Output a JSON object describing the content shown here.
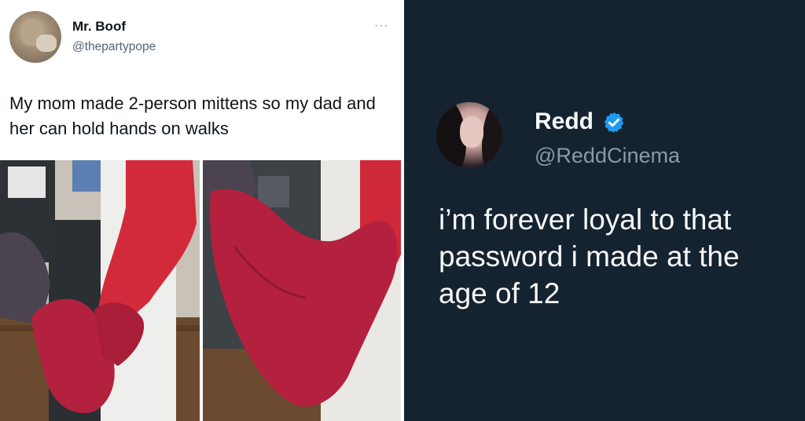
{
  "left_tweet": {
    "name": "Mr. Boof",
    "handle": "@thepartypope",
    "more_icon": "···",
    "text": "My mom made 2-person mittens so my dad and her can hold hands on walks",
    "photos": [
      "mittens-photo-1",
      "mittens-photo-2"
    ]
  },
  "right_tweet": {
    "name": "Redd",
    "handle": "@ReddCinema",
    "verified": true,
    "text": "i’m forever loyal to that password i made at the age of 12"
  },
  "colors": {
    "left_background": "#ffffff",
    "right_background": "#152230",
    "verified_blue": "#1d9bf0",
    "mitten_red": "#b3213f"
  }
}
